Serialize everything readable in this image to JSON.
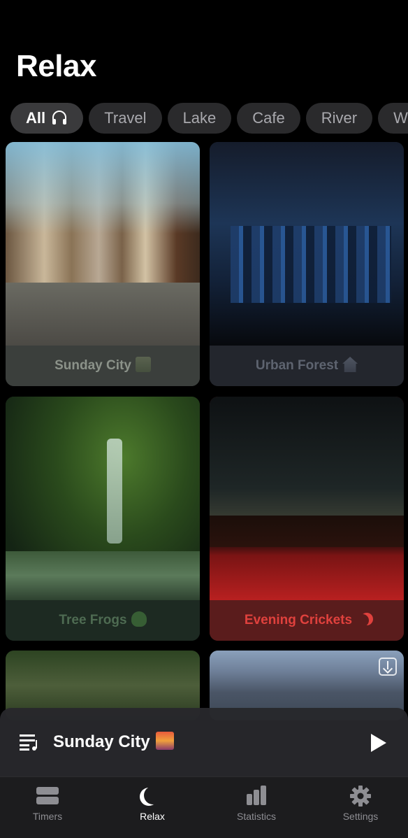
{
  "header": {
    "title": "Relax"
  },
  "categories": [
    {
      "label": "All",
      "active": true,
      "icon": "headphones-icon"
    },
    {
      "label": "Travel",
      "active": false
    },
    {
      "label": "Lake",
      "active": false
    },
    {
      "label": "Cafe",
      "active": false
    },
    {
      "label": "River",
      "active": false
    },
    {
      "label": "Wa",
      "active": false
    }
  ],
  "sounds": [
    {
      "title": "Sunday City",
      "icon": "cityscape-emoji"
    },
    {
      "title": "Urban Forest",
      "icon": "house-emoji"
    },
    {
      "title": "Tree Frogs",
      "icon": "frog-emoji"
    },
    {
      "title": "Evening Crickets",
      "icon": "crescent-moon-emoji"
    }
  ],
  "player": {
    "now_playing": "Sunday City",
    "icon": "cityscape-emoji"
  },
  "tabs": [
    {
      "label": "Timers",
      "icon": "timers-icon",
      "active": false
    },
    {
      "label": "Relax",
      "icon": "moon-icon",
      "active": true
    },
    {
      "label": "Statistics",
      "icon": "bar-chart-icon",
      "active": false
    },
    {
      "label": "Settings",
      "icon": "gear-icon",
      "active": false
    }
  ],
  "colors": {
    "background": "#000000",
    "chip_bg": "#2a2a2c",
    "evening_crickets_text": "#e0413d",
    "tabbar_bg": "#1c1c1e"
  }
}
